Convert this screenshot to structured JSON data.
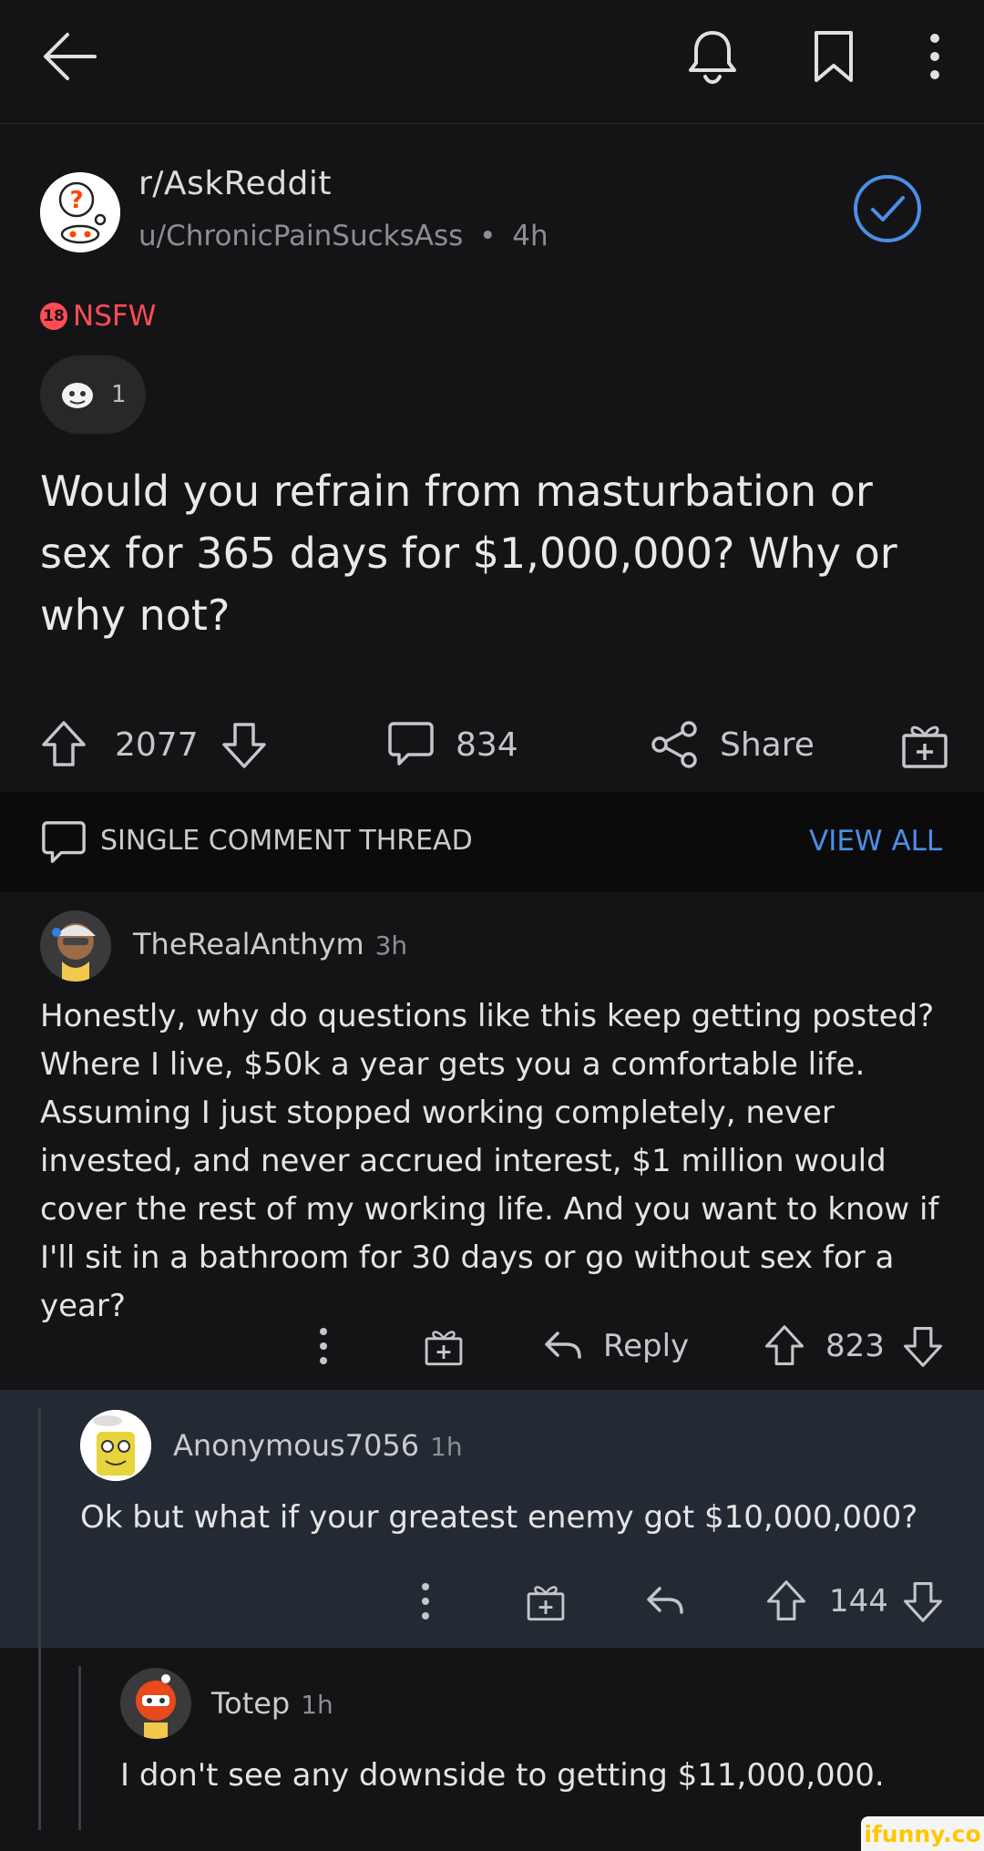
{
  "topbar": {
    "icons": [
      "back-arrow-icon",
      "bell-icon",
      "bookmark-icon",
      "more-vertical-icon"
    ]
  },
  "post": {
    "subreddit": "r/AskReddit",
    "author": "u/ChronicPainSucksAss",
    "separator": "•",
    "age": "4h",
    "nsfw_badge": "18",
    "nsfw_label": "NSFW",
    "award_count": "1",
    "title": "Would you refrain from masturbation or sex for 365 days for $1,000,000? Why or why not?",
    "upvotes": "2077",
    "comments": "834",
    "share_label": "Share",
    "accent": "#4a8fe7",
    "nsfw_color": "#ff4c55"
  },
  "thread": {
    "label": "SINGLE COMMENT THREAD",
    "view_all": "VIEW ALL"
  },
  "comments": [
    {
      "user": "TheRealAnthym",
      "age": "3h",
      "text": "Honestly, why do questions like this keep getting posted? Where I live, $50k a year gets you a comfortable life. Assuming I just stopped working completely, never invested, and never accrued interest, $1 million would cover the rest of my working life. And you want to know if I'll sit in a bathroom for 30 days or go without sex for a year?",
      "reply_label": "Reply",
      "votes": "823"
    },
    {
      "user": "Anonymous7056",
      "age": "1h",
      "text": "Ok but what if your greatest enemy got $10,000,000?",
      "votes": "144"
    },
    {
      "user": "Totep",
      "age": "1h",
      "text": "I don't see any downside to getting $11,000,000."
    }
  ],
  "watermark": "ifunny.co"
}
